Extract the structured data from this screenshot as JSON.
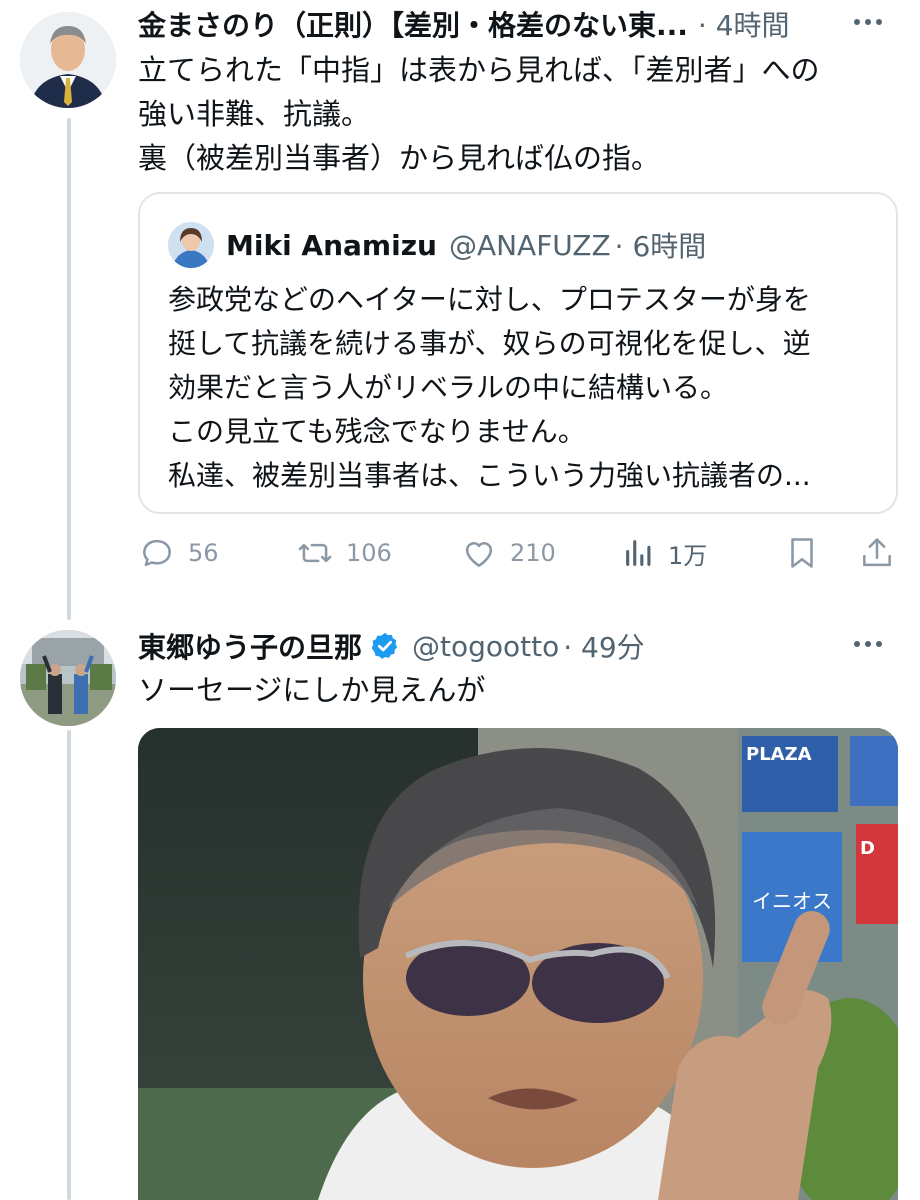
{
  "tweet1": {
    "author_name": "金まさのり（正則）【差別・格差のない東...",
    "time": "· 4時間",
    "text": "立てられた「中指」は表から見れば、「差別者」への\n強い非難、抗議。\n裏（被差別当事者）から見れば仏の指。",
    "quote": {
      "author_name": "Miki Anamizu",
      "handle": "@ANAFUZZ",
      "time": "· 6時間",
      "text": "参政党などのヘイターに対し、プロテスターが身を\n挺して抗議を続ける事が、奴らの可視化を促し、逆\n効果だと言う人がリベラルの中に結構いる。\nこの見立ても残念でなりません。\n私達、被差別当事者は、こういう力強い抗議者の..."
    },
    "stats": {
      "replies": "56",
      "retweets": "106",
      "likes": "210",
      "views": "1万"
    }
  },
  "tweet2": {
    "author_name": "東郷ゆう子の旦那",
    "handle": "@togootto",
    "time": "· 49分",
    "text": "ソーセージにしか見えんが",
    "media_sign_texts": [
      "PLAZA",
      "イニオス",
      "D"
    ]
  },
  "colors": {
    "text_primary": "#0f1419",
    "text_secondary": "#536471",
    "action_gray": "#8b98a5",
    "border": "#dfe5e8",
    "thread_line": "#cfd9de",
    "verified_blue": "#1d9bf0"
  },
  "icons": [
    "reply-icon",
    "retweet-icon",
    "like-icon",
    "views-icon",
    "bookmark-icon",
    "share-icon",
    "verified-badge-icon",
    "more-icon"
  ]
}
